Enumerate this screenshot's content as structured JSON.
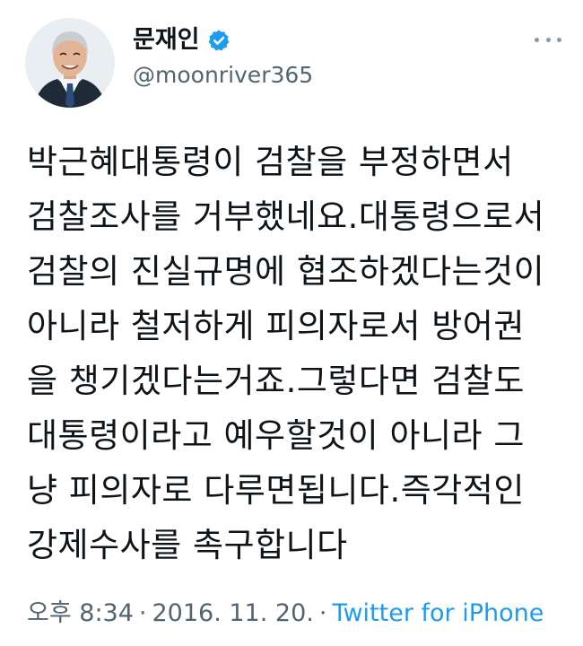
{
  "user": {
    "display_name": "문재인",
    "handle": "@moonriver365",
    "verified_icon": "verified-badge-icon",
    "avatar": "profile-photo"
  },
  "tweet": {
    "lines": [
      "박근혜대통령이 검찰을 부정하면서",
      "검찰조사를 거부했네요.대통령으로서",
      "검찰의 진실규명에 협조하겠다는것이",
      "아니라 철저하게 피의자로서 방어권",
      "을 챙기겠다는거죠.그렇다면 검찰도",
      "대통령이라고 예우할것이 아니라 그",
      "냥 피의자로 다루면됩니다.즉각적인",
      "강제수사를 촉구합니다"
    ]
  },
  "meta": {
    "time": "오후 8:34",
    "separator": "·",
    "date": "2016. 11. 20.",
    "source": "Twitter for iPhone"
  },
  "colors": {
    "text": "#0f1419",
    "secondary": "#536471",
    "link": "#1d9bf0",
    "verified": "#1d9bf0"
  }
}
